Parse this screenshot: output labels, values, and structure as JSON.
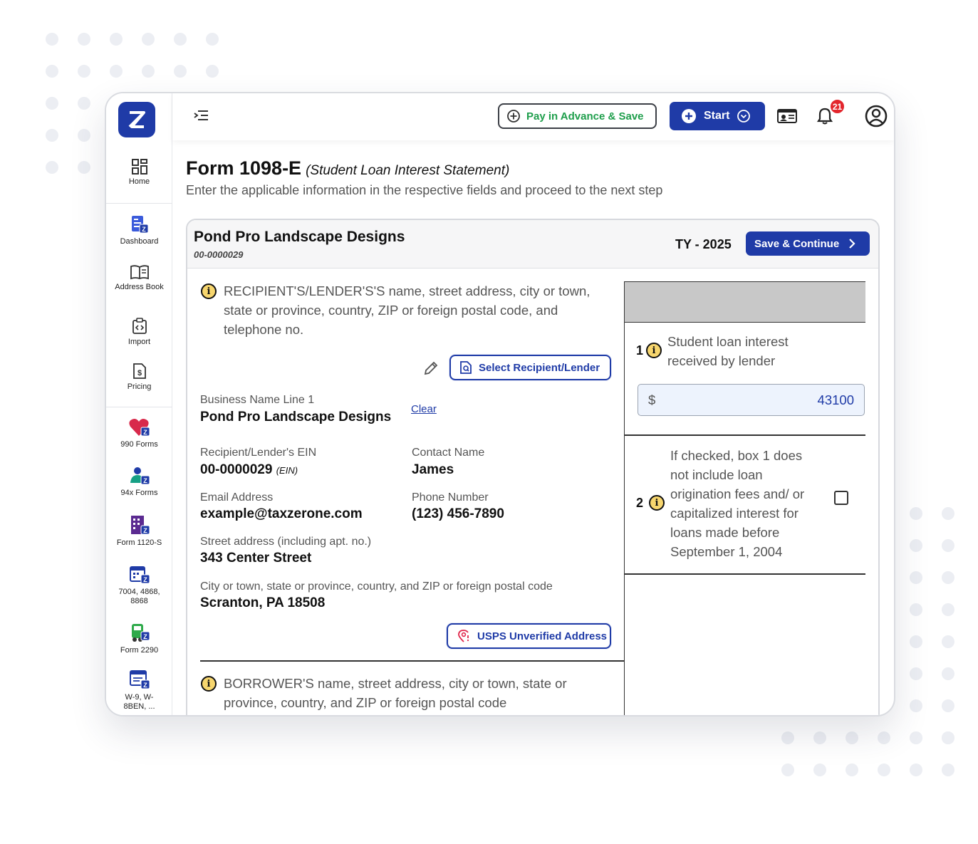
{
  "sidebar": {
    "items": [
      {
        "label": "Home",
        "icon": "grid-icon"
      },
      {
        "label": "Dashboard",
        "icon": "dashboard-icon"
      },
      {
        "label": "Address Book",
        "icon": "book-icon"
      },
      {
        "label": "Import",
        "icon": "import-icon"
      },
      {
        "label": "Pricing",
        "icon": "pricing-icon"
      },
      {
        "label": "990 Forms",
        "icon": "heart-icon"
      },
      {
        "label": "94x Forms",
        "icon": "person-icon"
      },
      {
        "label": "Form 1120-S",
        "icon": "building-icon"
      },
      {
        "label": "7004, 4868, 8868",
        "icon": "calendar-icon"
      },
      {
        "label": "Form 2290",
        "icon": "truck-icon"
      },
      {
        "label": "W-9, W-8BEN, ...",
        "icon": "form-icon"
      }
    ]
  },
  "topbar": {
    "pay_label": "Pay in Advance & Save",
    "start_label": "Start",
    "notification_count": "21"
  },
  "page": {
    "title": "Form 1098-E",
    "title_sub": "(Student Loan Interest Statement)",
    "subtitle": "Enter the applicable information in the respective fields and proceed to the next step"
  },
  "card": {
    "business_name": "Pond Pro Landscape Designs",
    "business_ein": "00-0000029",
    "tax_year": "TY - 2025",
    "save_label": "Save & Continue"
  },
  "recipient": {
    "heading": "RECIPIENT'S/LENDER'S'S name, street address, city or town, state or province, country, ZIP or foreign postal code, and telephone no.",
    "select_label": "Select Recipient/Lender",
    "business_name_label": "Business Name Line 1",
    "business_name": "Pond Pro Landscape Designs",
    "clear_label": "Clear",
    "ein_label": "Recipient/Lender's EIN",
    "ein": "00-0000029",
    "ein_tag": "(EIN)",
    "contact_label": "Contact Name",
    "contact": "James",
    "email_label": "Email Address",
    "email": "example@taxzerone.com",
    "phone_label": "Phone Number",
    "phone": "(123) 456-7890",
    "street_label": "Street address (including apt. no.)",
    "street": "343 Center Street",
    "city_label": "City or town, state or province, country, and ZIP or foreign postal code",
    "city": "Scranton, PA 18508",
    "usps_label": "USPS Unverified Address"
  },
  "borrower": {
    "heading": "BORROWER'S name, street address, city or town, state or province, country, and ZIP or foreign postal code"
  },
  "boxes": {
    "box1_num": "1",
    "box1_label": "Student loan interest received by lender",
    "currency": "$",
    "box1_value": "43100",
    "box2_num": "2",
    "box2_label": "If checked, box 1 does not include loan origination fees and/ or capitalized interest for loans made before September 1, 2004",
    "box2_checked": false
  }
}
